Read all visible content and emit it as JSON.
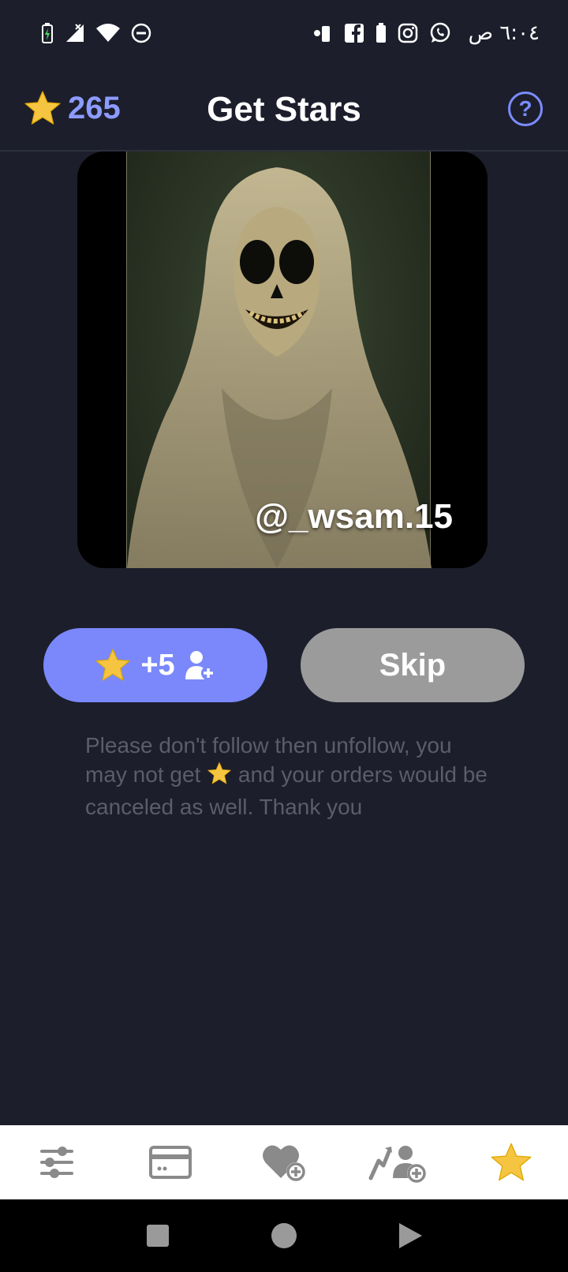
{
  "status_bar": {
    "time": "٦:٠٤ ص",
    "icons_left": [
      "battery-charging-icon",
      "signal-off-icon",
      "wifi-icon",
      "do-not-disturb-icon"
    ],
    "icons_right": [
      "notification-dot-icon",
      "facebook-icon",
      "battery-icon",
      "instagram-icon",
      "whatsapp-icon"
    ]
  },
  "header": {
    "star_balance": "265",
    "title": "Get Stars",
    "help_label": "?"
  },
  "media": {
    "handle": "@_wsam.15"
  },
  "actions": {
    "follow_reward": "+5",
    "skip_label": "Skip"
  },
  "notice": {
    "text_before": "Please don't follow then unfollow, you may not get",
    "text_after": "and your orders would be canceled as well. Thank you"
  },
  "bottom_nav": {
    "items": [
      "settings-sliders-icon",
      "card-icon",
      "heart-plus-icon",
      "follower-growth-icon",
      "star-icon"
    ],
    "active_index": 4
  },
  "colors": {
    "background": "#1c1e2b",
    "accent": "#7a88fb",
    "star": "#f5c542",
    "skip": "#9b9b9b"
  }
}
